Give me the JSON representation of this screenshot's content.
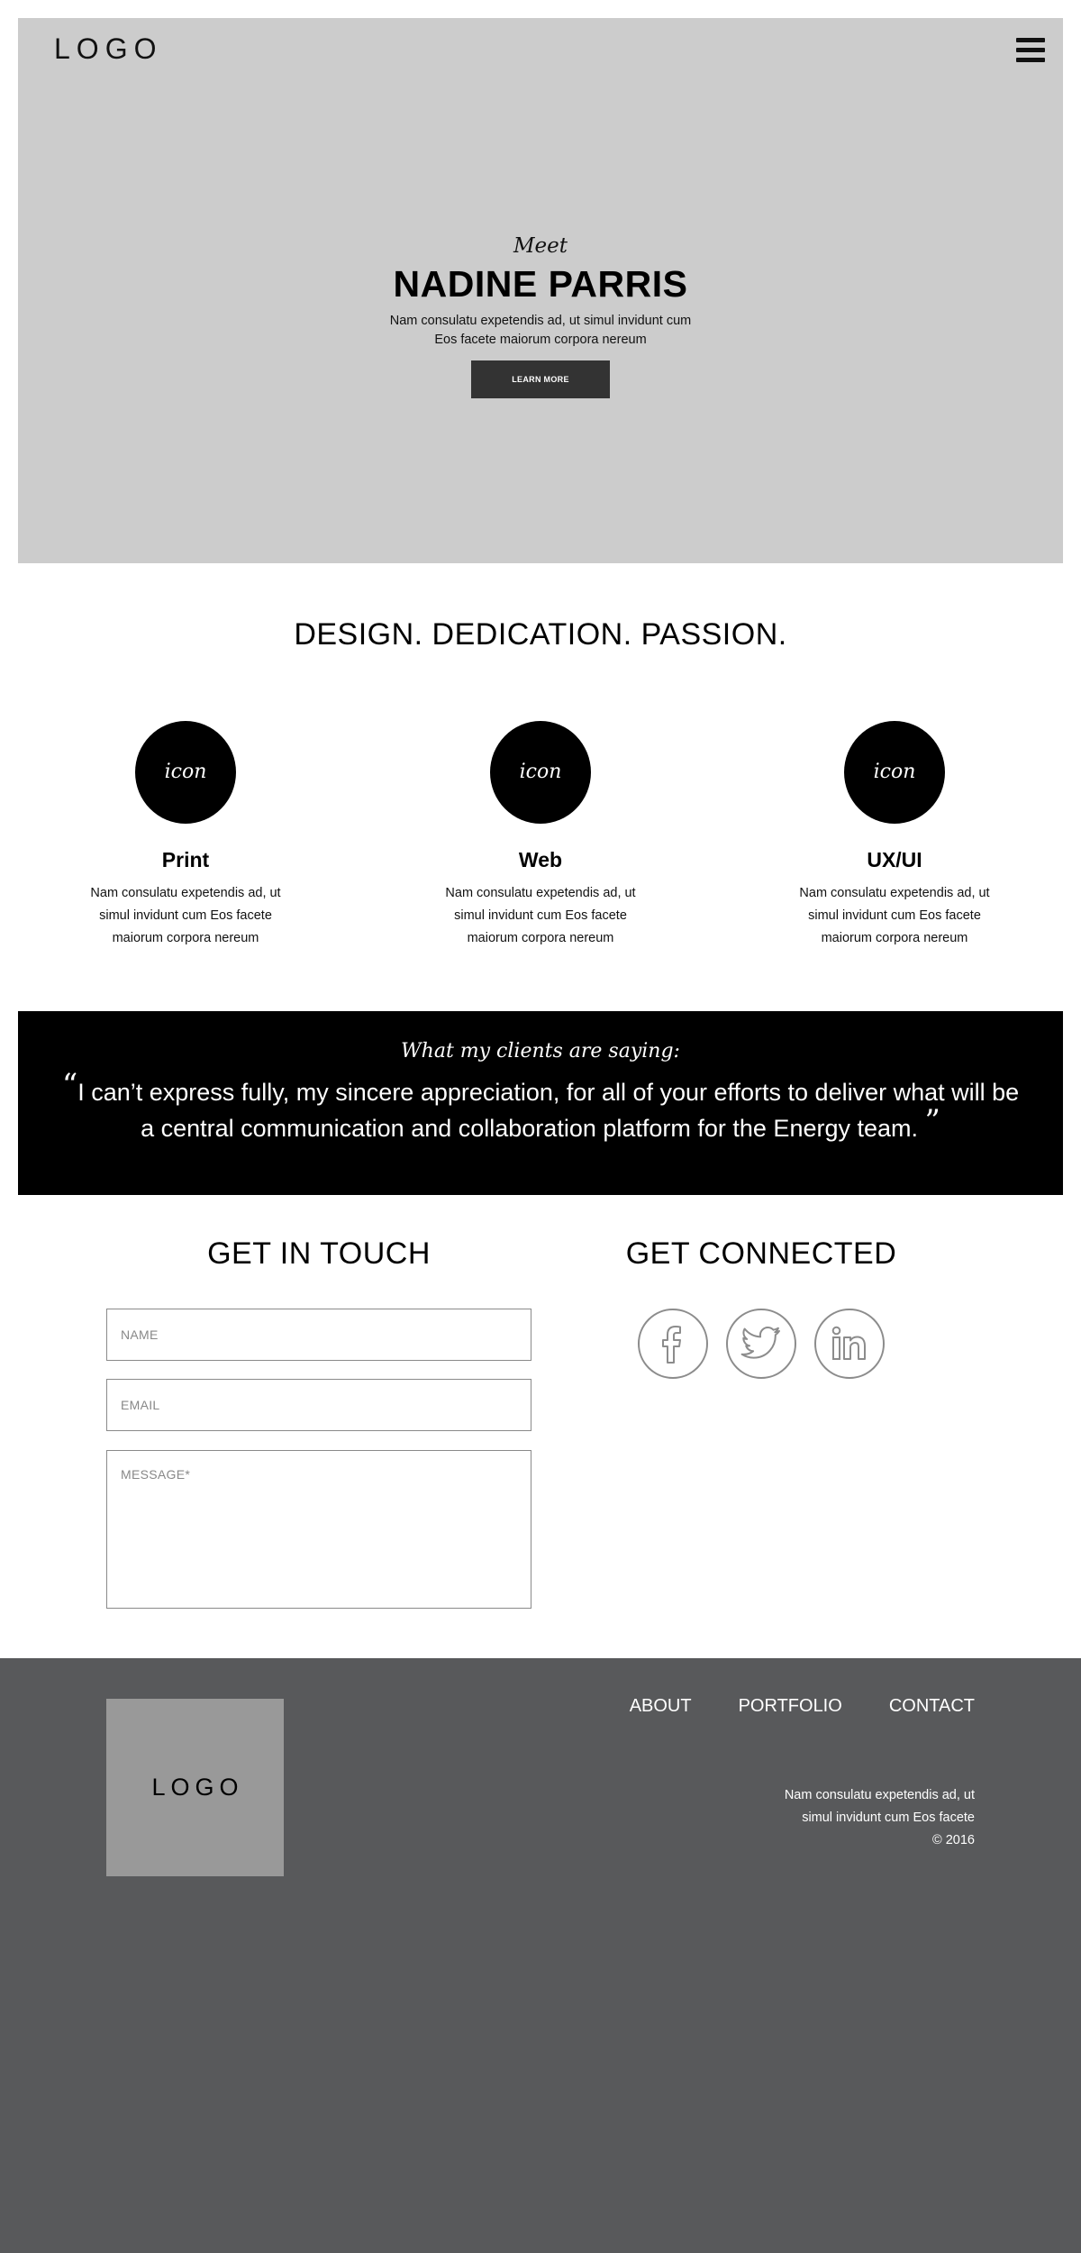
{
  "header": {
    "logo": "LOGO",
    "menu_icon": "hamburger-menu-icon"
  },
  "hero": {
    "meet": "Meet",
    "name": "NADINE PARRIS",
    "text_line1": "Nam consulatu expetendis ad, ut simul invidunt cum",
    "text_line2": "Eos facete maiorum corpora nereum",
    "button": "LEARN MORE"
  },
  "tagline": "DESIGN. DEDICATION. PASSION.",
  "services": [
    {
      "icon_label": "icon",
      "title": "Print",
      "line1": "Nam consulatu expetendis ad, ut",
      "line2": "simul invidunt cum Eos facete",
      "line3": "maiorum corpora nereum"
    },
    {
      "icon_label": "icon",
      "title": "Web",
      "line1": "Nam consulatu expetendis ad, ut",
      "line2": "simul invidunt cum Eos facete",
      "line3": "maiorum corpora nereum"
    },
    {
      "icon_label": "icon",
      "title": "UX/UI",
      "line1": "Nam consulatu expetendis ad, ut",
      "line2": "simul invidunt cum Eos facete",
      "line3": "maiorum corpora nereum"
    }
  ],
  "testimonial": {
    "heading": "What my clients are saying:",
    "open_quote": "“",
    "quote": "I can’t express fully, my sincere appreciation, for all of your efforts to deliver what will be a central communication and collaboration platform for the Energy team.",
    "close_quote": "”"
  },
  "contact": {
    "title": "GET IN TOUCH",
    "name_placeholder": "NAME",
    "email_placeholder": "EMAIL",
    "message_placeholder": "MESSAGE*"
  },
  "connect": {
    "title": "GET CONNECTED",
    "icons": [
      "facebook-icon",
      "twitter-icon",
      "linkedin-icon"
    ]
  },
  "footer": {
    "logo": "LOGO",
    "nav": [
      "ABOUT",
      "PORTFOLIO",
      "CONTACT"
    ],
    "text_line1": "Nam consulatu expetendis ad, ut",
    "text_line2": "simul invidunt cum Eos facete",
    "copyright": "© 2016"
  },
  "colors": {
    "hero_bg": "#cccccc",
    "button_bg": "#333333",
    "testimonial_bg": "#000000",
    "footer_bg": "#58595b",
    "footer_logo_bg": "#999999",
    "social_stroke": "#8c8c8c"
  }
}
